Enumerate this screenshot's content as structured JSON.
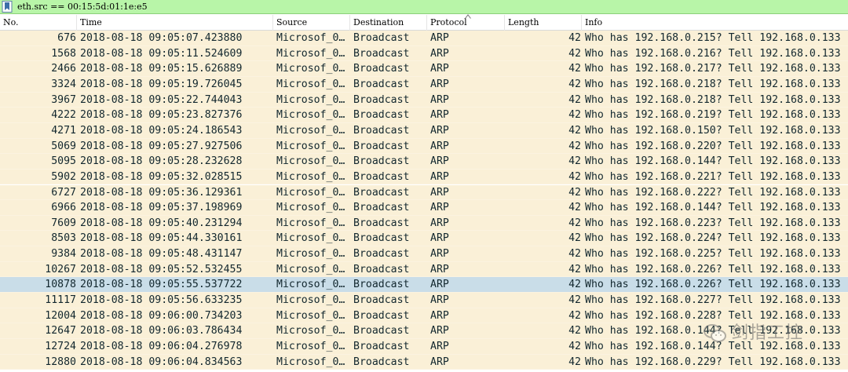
{
  "filter": {
    "expression": "eth.src == 00:15:5d:01:1e:e5",
    "icon": "bookmark-icon"
  },
  "columns": {
    "no": "No.",
    "time": "Time",
    "source": "Source",
    "destination": "Destination",
    "protocol": "Protocol",
    "length": "Length",
    "info": "Info"
  },
  "colors": {
    "filter_bg": "#b8f5a8",
    "row_bg": "#faf0d7",
    "selected_bg": "#c9dde8",
    "text": "#12272e"
  },
  "packets": [
    {
      "no": "676",
      "time": "2018-08-18 09:05:07.423880",
      "source": "Microsof_0…",
      "destination": "Broadcast",
      "protocol": "ARP",
      "length": "42",
      "info": "Who has 192.168.0.215? Tell 192.168.0.133",
      "selected": false
    },
    {
      "no": "1568",
      "time": "2018-08-18 09:05:11.524609",
      "source": "Microsof_0…",
      "destination": "Broadcast",
      "protocol": "ARP",
      "length": "42",
      "info": "Who has 192.168.0.216? Tell 192.168.0.133",
      "selected": false
    },
    {
      "no": "2466",
      "time": "2018-08-18 09:05:15.626889",
      "source": "Microsof_0…",
      "destination": "Broadcast",
      "protocol": "ARP",
      "length": "42",
      "info": "Who has 192.168.0.217? Tell 192.168.0.133",
      "selected": false
    },
    {
      "no": "3324",
      "time": "2018-08-18 09:05:19.726045",
      "source": "Microsof_0…",
      "destination": "Broadcast",
      "protocol": "ARP",
      "length": "42",
      "info": "Who has 192.168.0.218? Tell 192.168.0.133",
      "selected": false
    },
    {
      "no": "3967",
      "time": "2018-08-18 09:05:22.744043",
      "source": "Microsof_0…",
      "destination": "Broadcast",
      "protocol": "ARP",
      "length": "42",
      "info": "Who has 192.168.0.218? Tell 192.168.0.133",
      "selected": false
    },
    {
      "no": "4222",
      "time": "2018-08-18 09:05:23.827376",
      "source": "Microsof_0…",
      "destination": "Broadcast",
      "protocol": "ARP",
      "length": "42",
      "info": "Who has 192.168.0.219? Tell 192.168.0.133",
      "selected": false
    },
    {
      "no": "4271",
      "time": "2018-08-18 09:05:24.186543",
      "source": "Microsof_0…",
      "destination": "Broadcast",
      "protocol": "ARP",
      "length": "42",
      "info": "Who has 192.168.0.150? Tell 192.168.0.133",
      "selected": false
    },
    {
      "no": "5069",
      "time": "2018-08-18 09:05:27.927506",
      "source": "Microsof_0…",
      "destination": "Broadcast",
      "protocol": "ARP",
      "length": "42",
      "info": "Who has 192.168.0.220? Tell 192.168.0.133",
      "selected": false
    },
    {
      "no": "5095",
      "time": "2018-08-18 09:05:28.232628",
      "source": "Microsof_0…",
      "destination": "Broadcast",
      "protocol": "ARP",
      "length": "42",
      "info": "Who has 192.168.0.144? Tell 192.168.0.133",
      "selected": false
    },
    {
      "no": "5902",
      "time": "2018-08-18 09:05:32.028515",
      "source": "Microsof_0…",
      "destination": "Broadcast",
      "protocol": "ARP",
      "length": "42",
      "info": "Who has 192.168.0.221? Tell 192.168.0.133",
      "selected": false
    },
    {
      "no": "6727",
      "time": "2018-08-18 09:05:36.129361",
      "source": "Microsof_0…",
      "destination": "Broadcast",
      "protocol": "ARP",
      "length": "42",
      "info": "Who has 192.168.0.222? Tell 192.168.0.133",
      "selected": false
    },
    {
      "no": "6966",
      "time": "2018-08-18 09:05:37.198969",
      "source": "Microsof_0…",
      "destination": "Broadcast",
      "protocol": "ARP",
      "length": "42",
      "info": "Who has 192.168.0.144? Tell 192.168.0.133",
      "selected": false
    },
    {
      "no": "7609",
      "time": "2018-08-18 09:05:40.231294",
      "source": "Microsof_0…",
      "destination": "Broadcast",
      "protocol": "ARP",
      "length": "42",
      "info": "Who has 192.168.0.223? Tell 192.168.0.133",
      "selected": false
    },
    {
      "no": "8503",
      "time": "2018-08-18 09:05:44.330161",
      "source": "Microsof_0…",
      "destination": "Broadcast",
      "protocol": "ARP",
      "length": "42",
      "info": "Who has 192.168.0.224? Tell 192.168.0.133",
      "selected": false
    },
    {
      "no": "9384",
      "time": "2018-08-18 09:05:48.431147",
      "source": "Microsof_0…",
      "destination": "Broadcast",
      "protocol": "ARP",
      "length": "42",
      "info": "Who has 192.168.0.225? Tell 192.168.0.133",
      "selected": false
    },
    {
      "no": "10267",
      "time": "2018-08-18 09:05:52.532455",
      "source": "Microsof_0…",
      "destination": "Broadcast",
      "protocol": "ARP",
      "length": "42",
      "info": "Who has 192.168.0.226? Tell 192.168.0.133",
      "selected": false
    },
    {
      "no": "10878",
      "time": "2018-08-18 09:05:55.537722",
      "source": "Microsof_0…",
      "destination": "Broadcast",
      "protocol": "ARP",
      "length": "42",
      "info": "Who has 192.168.0.226? Tell 192.168.0.133",
      "selected": true
    },
    {
      "no": "11117",
      "time": "2018-08-18 09:05:56.633235",
      "source": "Microsof_0…",
      "destination": "Broadcast",
      "protocol": "ARP",
      "length": "42",
      "info": "Who has 192.168.0.227? Tell 192.168.0.133",
      "selected": false
    },
    {
      "no": "12004",
      "time": "2018-08-18 09:06:00.734203",
      "source": "Microsof_0…",
      "destination": "Broadcast",
      "protocol": "ARP",
      "length": "42",
      "info": "Who has 192.168.0.228? Tell 192.168.0.133",
      "selected": false
    },
    {
      "no": "12647",
      "time": "2018-08-18 09:06:03.786434",
      "source": "Microsof_0…",
      "destination": "Broadcast",
      "protocol": "ARP",
      "length": "42",
      "info": "Who has 192.168.0.144? Tell 192.168.0.133",
      "selected": false
    },
    {
      "no": "12724",
      "time": "2018-08-18 09:06:04.276978",
      "source": "Microsof_0…",
      "destination": "Broadcast",
      "protocol": "ARP",
      "length": "42",
      "info": "Who has 192.168.0.144? Tell 192.168.0.133",
      "selected": false
    },
    {
      "no": "12880",
      "time": "2018-08-18 09:06:04.834563",
      "source": "Microsof_0…",
      "destination": "Broadcast",
      "protocol": "ARP",
      "length": "42",
      "info": "Who has 192.168.0.229? Tell 192.168.0.133",
      "selected": false
    }
  ],
  "watermark": {
    "text": "剑指工控",
    "icon": "wechat-logo-icon"
  }
}
